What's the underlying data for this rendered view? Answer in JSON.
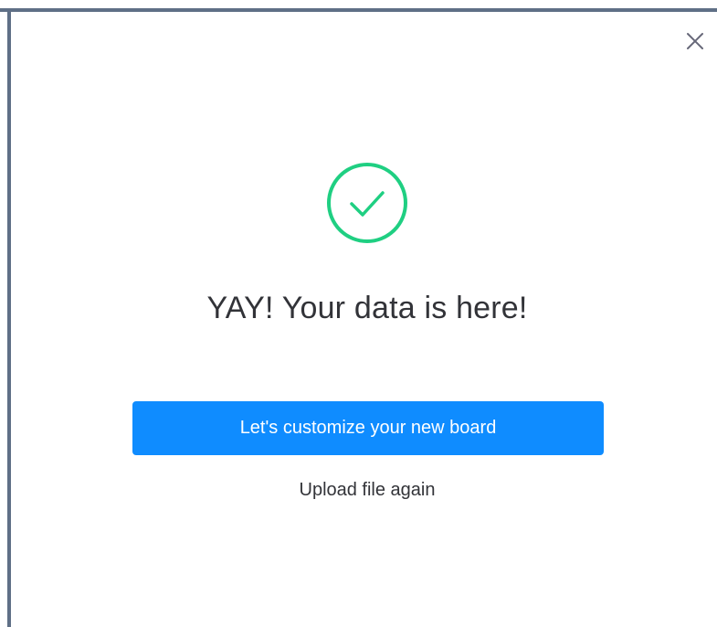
{
  "dialog": {
    "headline": "YAY! Your data is here!",
    "primary_button_label": "Let's customize your new board",
    "secondary_link_label": "Upload file again"
  },
  "icons": {
    "close": "close-icon",
    "success": "check-circle-icon"
  },
  "colors": {
    "primary": "#0f8cff",
    "success": "#1fcf82",
    "text": "#323338",
    "frame_border": "#5f6f86"
  }
}
